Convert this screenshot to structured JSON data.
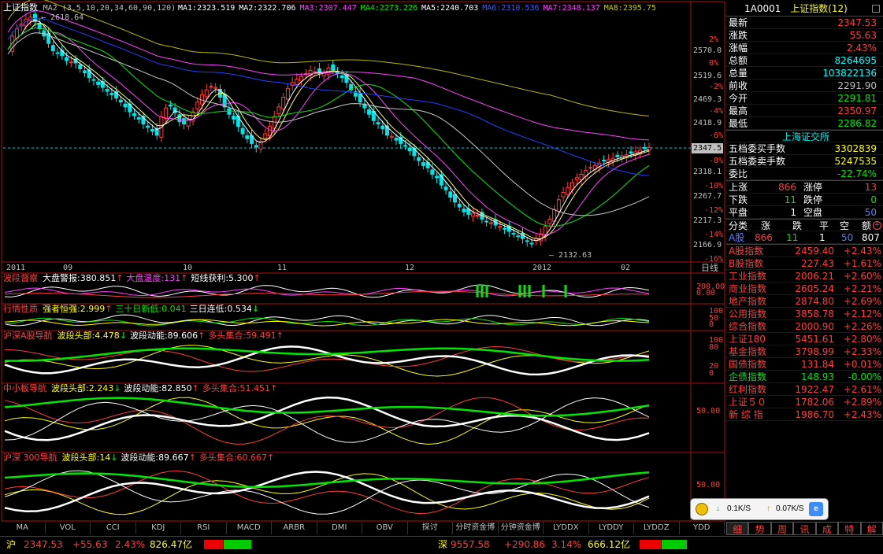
{
  "main": {
    "title": "上证指数",
    "ma_params": "MA2 (3,5,10,20,34,60,90,120)",
    "ma_values": [
      {
        "label": "MA1:2323.519",
        "color": "#ffffff"
      },
      {
        "label": "MA2:2322.706",
        "color": "#ffffff"
      },
      {
        "label": "MA3:2307.447",
        "color": "#ff40ff"
      },
      {
        "label": "MA4:2273.226",
        "color": "#00e600"
      },
      {
        "label": "MA5:2240.703",
        "color": "#ffffff"
      },
      {
        "label": "MA6:2310.536",
        "color": "#3a5cff"
      },
      {
        "label": "MA7:2348.137",
        "color": "#ff40ff"
      },
      {
        "label": "MA8:2395.75",
        "color": "#c8c800"
      }
    ],
    "high_label": "2618.64",
    "low_label": "2132.63",
    "current_price_tag": "2347.5",
    "price_ticks": [
      "2570.0",
      "2519.6",
      "2469.3",
      "2418.9",
      "2318.1",
      "2267.7",
      "2217.3",
      "2166.9"
    ],
    "pct_ticks": [
      "2%",
      "0%",
      "-2%",
      "-4%",
      "-6%",
      "-8%",
      "-10%",
      "-12%",
      "-14%",
      "-16%"
    ],
    "date_ticks": [
      "2011",
      "09",
      "10",
      "11",
      "12",
      "2012",
      "02"
    ],
    "period": "日线"
  },
  "chart_data": {
    "type": "candlestick",
    "title": "上证指数",
    "ylim": [
      2130,
      2620
    ],
    "high": 2618.64,
    "low": 2132.63,
    "last": 2347.53,
    "close_series": [
      2548,
      2575,
      2590,
      2600,
      2610,
      2614,
      2605,
      2590,
      2575,
      2560,
      2545,
      2540,
      2535,
      2525,
      2522,
      2520,
      2508,
      2500,
      2490,
      2485,
      2476,
      2470,
      2462,
      2455,
      2448,
      2440,
      2430,
      2420,
      2412,
      2405,
      2395,
      2388,
      2380,
      2372,
      2410,
      2428,
      2432,
      2418,
      2400,
      2395,
      2405,
      2420,
      2440,
      2455,
      2465,
      2472,
      2470,
      2450,
      2430,
      2415,
      2405,
      2390,
      2375,
      2365,
      2355,
      2348,
      2360,
      2375,
      2390,
      2410,
      2430,
      2450,
      2468,
      2480,
      2487,
      2492,
      2498,
      2505,
      2502,
      2498,
      2500,
      2510,
      2505,
      2498,
      2490,
      2480,
      2465,
      2452,
      2440,
      2428,
      2415,
      2402,
      2395,
      2385,
      2372,
      2370,
      2362,
      2355,
      2350,
      2340,
      2330,
      2320,
      2310,
      2305,
      2292,
      2285,
      2270,
      2260,
      2245,
      2235,
      2225,
      2215,
      2210,
      2212,
      2208,
      2200,
      2195,
      2193,
      2188,
      2185,
      2180,
      2175,
      2170,
      2165,
      2160,
      2155,
      2150,
      2160,
      2170,
      2185,
      2200,
      2220,
      2240,
      2255,
      2265,
      2275,
      2285,
      2292,
      2300,
      2306,
      2310,
      2315,
      2320,
      2322,
      2325,
      2328,
      2330,
      2332,
      2335,
      2338,
      2341,
      2345,
      2347
    ]
  },
  "indicators": [
    {
      "name": "波段督察",
      "items": [
        {
          "label": "大盘警报:380.851",
          "arrow": "↑",
          "color": "#ffffff"
        },
        {
          "label": "大盘温度:131",
          "arrow": "↑",
          "color": "#ff40ff"
        },
        {
          "label": "短线获利:5.300",
          "arrow": "↑",
          "color": "#ffffff"
        }
      ],
      "ticks": [
        "200.00",
        "0.00"
      ]
    },
    {
      "name": "行情性质",
      "items": [
        {
          "label": "强者恒强:2.999",
          "arrow": "↑",
          "color": "#ffff00"
        },
        {
          "label": "三十日新低:0.041",
          "arrow": "",
          "color": "#00e600"
        },
        {
          "label": "三日连低:0.534",
          "arrow": "↓",
          "color": "#ffffff"
        }
      ],
      "ticks": [
        "100",
        "50",
        "0"
      ]
    },
    {
      "name": "沪深A股导航",
      "items": [
        {
          "label": "波段头部:4.478",
          "arrow": "↓",
          "color": "#ffff00"
        },
        {
          "label": "波段动能:89.606",
          "arrow": "↑",
          "color": "#ffffff"
        },
        {
          "label": "多头集合:59.491",
          "arrow": "↑",
          "color": "#ff3c3c"
        }
      ],
      "ticks": [
        "100",
        "80",
        "20",
        "0"
      ]
    },
    {
      "name": "中小板导航",
      "items": [
        {
          "label": "波段头部:2.243",
          "arrow": "↓",
          "color": "#ffff00"
        },
        {
          "label": "波段动能:82.850",
          "arrow": "↑",
          "color": "#ffffff"
        },
        {
          "label": "多头集合:51.451",
          "arrow": "↑",
          "color": "#ff3c3c"
        }
      ],
      "ticks": [
        "50.00"
      ]
    },
    {
      "name": "沪深 300导航",
      "items": [
        {
          "label": "波段头部:14",
          "arrow": "↓",
          "color": "#ffff00"
        },
        {
          "label": "波段动能:89.667",
          "arrow": "↑",
          "color": "#ffffff"
        },
        {
          "label": "多头集合:60.667",
          "arrow": "↑",
          "color": "#ff3c3c"
        }
      ],
      "ticks": [
        "50.00"
      ]
    }
  ],
  "tabs": [
    "MA",
    "VOL",
    "CCI",
    "KDJ",
    "RSI",
    "MACD",
    "ARBR",
    "DMI",
    "OBV",
    "探讨",
    "分时资金博",
    "分钟资金博",
    "LYDDX",
    "LYDDY",
    "LYDDZ",
    "YDD"
  ],
  "right_panel": {
    "code": "1A0001",
    "name": "上证指数",
    "badge": "(12)",
    "quote": [
      {
        "label": "最新",
        "value": "2347.53",
        "color": "#ff3c3c"
      },
      {
        "label": "涨跌",
        "value": "55.63",
        "color": "#ff3c3c"
      },
      {
        "label": "涨幅",
        "value": "2.43%",
        "color": "#ff3c3c"
      },
      {
        "label": "总额",
        "value": "8264695",
        "color": "#00ffff"
      },
      {
        "label": "总量",
        "value": "103822136",
        "color": "#00ffff"
      },
      {
        "label": "前收",
        "value": "2291.90",
        "color": "#c0c0c0"
      },
      {
        "label": "今开",
        "value": "2291.81",
        "color": "#00e600"
      },
      {
        "label": "最高",
        "value": "2350.97",
        "color": "#ff3c3c"
      },
      {
        "label": "最低",
        "value": "2286.82",
        "color": "#00e600"
      }
    ],
    "exchange": "上海证交所",
    "orders": [
      {
        "label": "五档委买手数",
        "value": "3302839",
        "color": "#ffff00"
      },
      {
        "label": "五档委卖手数",
        "value": "5247535",
        "color": "#ffff00"
      },
      {
        "label": "委比",
        "value": "-22.74%",
        "color": "#00e600"
      }
    ],
    "breadth": [
      {
        "l1": "上涨",
        "v1": "866",
        "c1": "#ff3c3c",
        "l2": "涨停",
        "v2": "13",
        "c2": "#ff3c3c"
      },
      {
        "l1": "下跌",
        "v1": "11",
        "c1": "#00e600",
        "l2": "跌停",
        "v2": "0",
        "c2": "#00e600"
      },
      {
        "l1": "平盘",
        "v1": "1",
        "c1": "#ffffff",
        "l2": "空盘",
        "v2": "50",
        "c2": "#5a7dff"
      }
    ],
    "class_header": [
      "分类",
      "涨",
      "跌",
      "平",
      "空",
      "额"
    ],
    "class_row": {
      "name": "A股",
      "up": "866",
      "down": "11",
      "flat": "1",
      "empty": "50",
      "amount": "807"
    },
    "indices": [
      {
        "name": "A股指数",
        "value": "2459.40",
        "pct": "+2.43%"
      },
      {
        "name": "B股指数",
        "value": "227.43",
        "pct": "+1.61%"
      },
      {
        "name": "工业指数",
        "value": "2006.21",
        "pct": "+2.60%"
      },
      {
        "name": "商业指数",
        "value": "2605.24",
        "pct": "+2.21%"
      },
      {
        "name": "地产指数",
        "value": "2874.80",
        "pct": "+2.69%"
      },
      {
        "name": "公用指数",
        "value": "3858.78",
        "pct": "+2.12%"
      },
      {
        "name": "综合指数",
        "value": "2000.90",
        "pct": "+2.26%"
      },
      {
        "name": "上证180",
        "value": "5451.61",
        "pct": "+2.80%"
      },
      {
        "name": "基金指数",
        "value": "3798.99",
        "pct": "+2.33%"
      },
      {
        "name": "国债指数",
        "value": "131.84",
        "pct": "+0.01%"
      },
      {
        "name": "企债指数",
        "value": "148.93",
        "pct": "-0.00%",
        "color": "#00e600"
      },
      {
        "name": "红利指数",
        "value": "1922.47",
        "pct": "+2.61%"
      },
      {
        "name": "上证５０",
        "value": "1782.06",
        "pct": "+2.89%"
      },
      {
        "name": "新 综 指",
        "value": "1986.70",
        "pct": "+2.43%"
      }
    ],
    "bottom_tabs": [
      "细",
      "势",
      "周",
      "讯",
      "成",
      "特",
      "解"
    ]
  },
  "popup": {
    "down": "0.1K/S",
    "up": "0.07K/S"
  },
  "status": {
    "sh_label": "沪",
    "sh_price": "2347.53",
    "sh_chg": "+55.63",
    "sh_pct": "2.43%",
    "sh_amt": "826.47亿",
    "sz_label": "深",
    "sz_price": "9557.58",
    "sz_chg": "+290.86",
    "sz_pct": "3.14%",
    "sz_amt": "666.12亿"
  },
  "colors": {
    "up": "#ff3c3c",
    "down": "#00e6e6",
    "grid": "#8b0000",
    "bg": "#000000"
  }
}
